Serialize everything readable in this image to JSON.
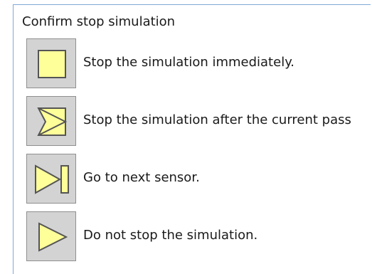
{
  "dialog": {
    "title": "Confirm stop simulation",
    "options": [
      {
        "icon": "stop-square-icon",
        "label": "Stop the simulation immediately."
      },
      {
        "icon": "stop-after-pass-icon",
        "label": "Stop the simulation after the current pass"
      },
      {
        "icon": "next-sensor-icon",
        "label": "Go to next sensor."
      },
      {
        "icon": "play-triangle-icon",
        "label": "Do not stop the simulation."
      }
    ]
  },
  "colors": {
    "icon_fill": "#ffff99",
    "icon_stroke": "#555555",
    "button_bg": "#d3d3d3",
    "border_accent": "#7fa9d6"
  }
}
